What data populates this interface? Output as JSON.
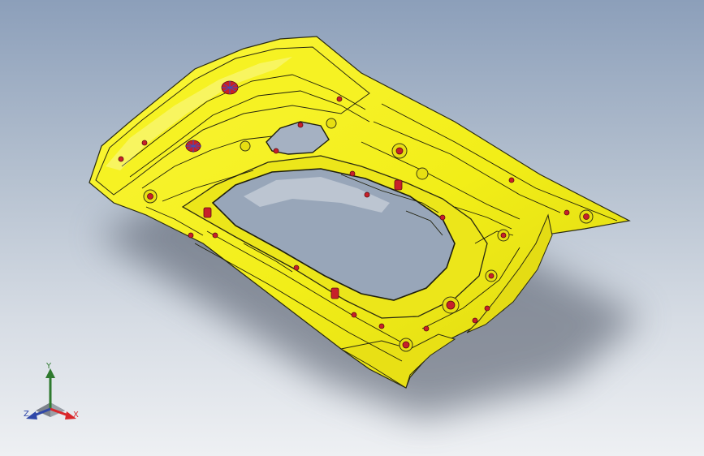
{
  "viewport": {
    "background_top": "#8c9fba",
    "background_bottom": "#eef0f3",
    "model": {
      "kind": "sheet-metal-inner-panel",
      "body_color": "#f2ee18",
      "shadow_color": "#6f7785",
      "feature_color": "#c7202a",
      "edge_color": "#1e1e0a"
    }
  },
  "triad": {
    "y_label": "Y",
    "x_label": "X",
    "z_label": "Z",
    "y_color": "#2f7a2f",
    "x_color": "#d9262a",
    "z_color": "#2f47a8"
  }
}
